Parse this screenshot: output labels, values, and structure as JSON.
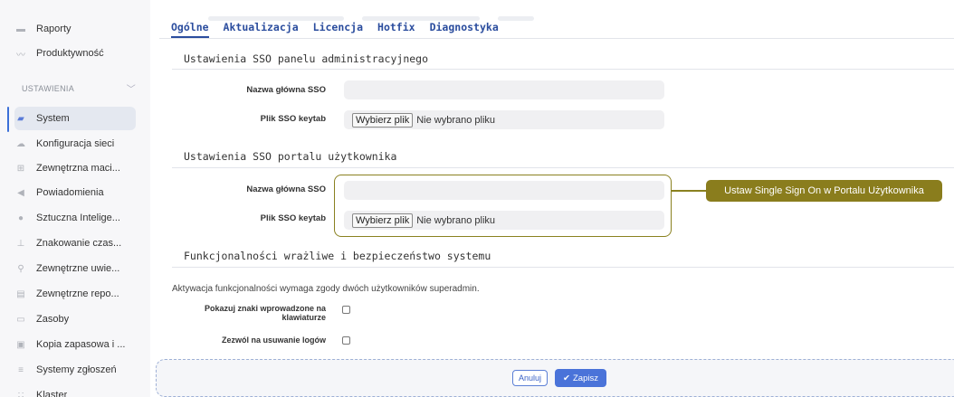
{
  "sidebar": {
    "items_top": [
      {
        "label": "Raporty",
        "icon": "printer-icon"
      },
      {
        "label": "Produktywność",
        "icon": "chart-icon"
      }
    ],
    "section_label": "USTAWIENIA",
    "items": [
      {
        "label": "System",
        "icon": "folder-icon",
        "active": true
      },
      {
        "label": "Konfiguracja sieci",
        "icon": "network-icon"
      },
      {
        "label": "Zewnętrzna maci...",
        "icon": "sitemap-icon"
      },
      {
        "label": "Powiadomienia",
        "icon": "megaphone-icon"
      },
      {
        "label": "Sztuczna Intelige...",
        "icon": "brain-icon"
      },
      {
        "label": "Znakowanie czas...",
        "icon": "stamp-icon"
      },
      {
        "label": "Zewnętrzne uwie...",
        "icon": "key-icon"
      },
      {
        "label": "Zewnętrzne repo...",
        "icon": "archive-icon"
      },
      {
        "label": "Zasoby",
        "icon": "resources-icon"
      },
      {
        "label": "Kopia zapasowa i ...",
        "icon": "backup-icon"
      },
      {
        "label": "Systemy zgłoszeń",
        "icon": "ticket-icon"
      },
      {
        "label": "Klaster",
        "icon": "cluster-icon"
      }
    ]
  },
  "tabs": [
    "Ogólne",
    "Aktualizacja",
    "Licencja",
    "Hotfix",
    "Diagnostyka"
  ],
  "admin_sso": {
    "title": "Ustawienia SSO panelu administracyjnego",
    "principal_label": "Nazwa główna SSO",
    "principal_value": "",
    "keytab_label": "Plik SSO keytab",
    "file_button": "Wybierz plik",
    "file_status": "Nie wybrano pliku"
  },
  "user_sso": {
    "title": "Ustawienia SSO portalu użytkownika",
    "principal_label": "Nazwa główna SSO",
    "principal_value": "",
    "keytab_label": "Plik SSO keytab",
    "file_button": "Wybierz plik",
    "file_status": "Nie wybrano pliku"
  },
  "callout": {
    "text": "Ustaw Single Sign On w Portalu Użytkownika",
    "color": "#8a7d1d"
  },
  "security": {
    "title": "Funkcjonalności wrażliwe i bezpieczeństwo systemu",
    "note": "Aktywacja funkcjonalności wymaga zgody dwóch użytkowników superadmin.",
    "checkbox1_label": "Pokazuj znaki wprowadzone na klawiaturze",
    "checkbox1_checked": false,
    "checkbox2_label": "Zezwól na usuwanie logów",
    "checkbox2_checked": false
  },
  "footer": {
    "cancel_label": "Anuluj",
    "save_label": "Zapisz"
  },
  "colors": {
    "accent": "#2b4d9e",
    "primary_button": "#4a73d9"
  }
}
